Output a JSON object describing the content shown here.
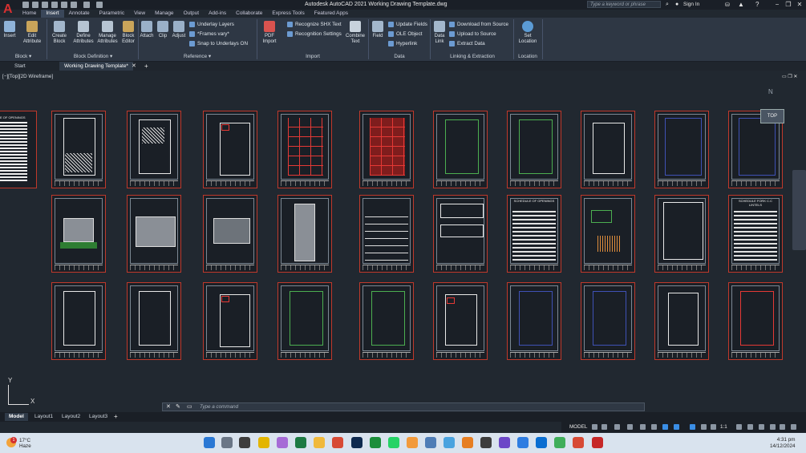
{
  "window": {
    "title": "Autodesk AutoCAD 2021    Working Drawing Template.dwg",
    "search_placeholder": "Type a keyword or phrase",
    "sign_in": "Sign In"
  },
  "ribbon_tabs": [
    "Home",
    "Insert",
    "Annotate",
    "Parametric",
    "View",
    "Manage",
    "Output",
    "Add-ins",
    "Collaborate",
    "Express Tools",
    "Featured Apps"
  ],
  "active_tab": "Insert",
  "ribbon": {
    "block": {
      "label": "Block ▾",
      "insert": "Insert",
      "edit_attribute": "Edit Attribute"
    },
    "block_definition": {
      "label": "Block Definition ▾",
      "create_block": "Create Block",
      "define_attributes": "Define Attributes",
      "manage_attributes": "Manage Attributes",
      "block_editor": "Block Editor"
    },
    "reference": {
      "label": "Reference ▾",
      "attach": "Attach",
      "clip": "Clip",
      "adjust": "Adjust",
      "underlay_layers": "Underlay Layers",
      "frames_vary": "*Frames vary*",
      "snap_underlays": "Snap to Underlays ON"
    },
    "import": {
      "label": "Import",
      "pdf_import": "PDF Import",
      "recognize_shx": "Recognize SHX Text",
      "recognition_settings": "Recognition Settings",
      "combine_text": "Combine Text"
    },
    "data": {
      "label": "Data",
      "field": "Field",
      "update_fields": "Update Fields",
      "ole_object": "OLE Object",
      "hyperlink": "Hyperlink"
    },
    "linking": {
      "label": "Linking & Extraction",
      "data_link": "Data Link",
      "download_source": "Download from Source",
      "upload_source": "Upload to Source",
      "extract_data": "Extract  Data"
    },
    "location": {
      "label": "Location",
      "set_location": "Set Location"
    }
  },
  "doc_tabs": [
    "Start",
    "Working Drawing Template*"
  ],
  "viewport": {
    "label": "[−][Top][2D Wireframe]",
    "viewcube_top": "TOP",
    "viewcube_n": "N"
  },
  "sheet_texts": {
    "schedule_openings": "SCHEDULE OF OPENINGS",
    "schedule_footings": "SCHEDULE FORK C.C LINTELS",
    "partial_header": "E OF OPENINGS"
  },
  "ucs": {
    "y": "Y",
    "x": "X"
  },
  "command_line": {
    "placeholder": "Type a command"
  },
  "layout_tabs": [
    "Model",
    "Layout1",
    "Layout2",
    "Layout3"
  ],
  "status": {
    "model": "MODEL",
    "scale": "1:1"
  },
  "taskbar": {
    "temp": "17°C",
    "weather": "Haze",
    "time": "4:31 pm",
    "date": "14/12/2024",
    "notif": "1"
  }
}
